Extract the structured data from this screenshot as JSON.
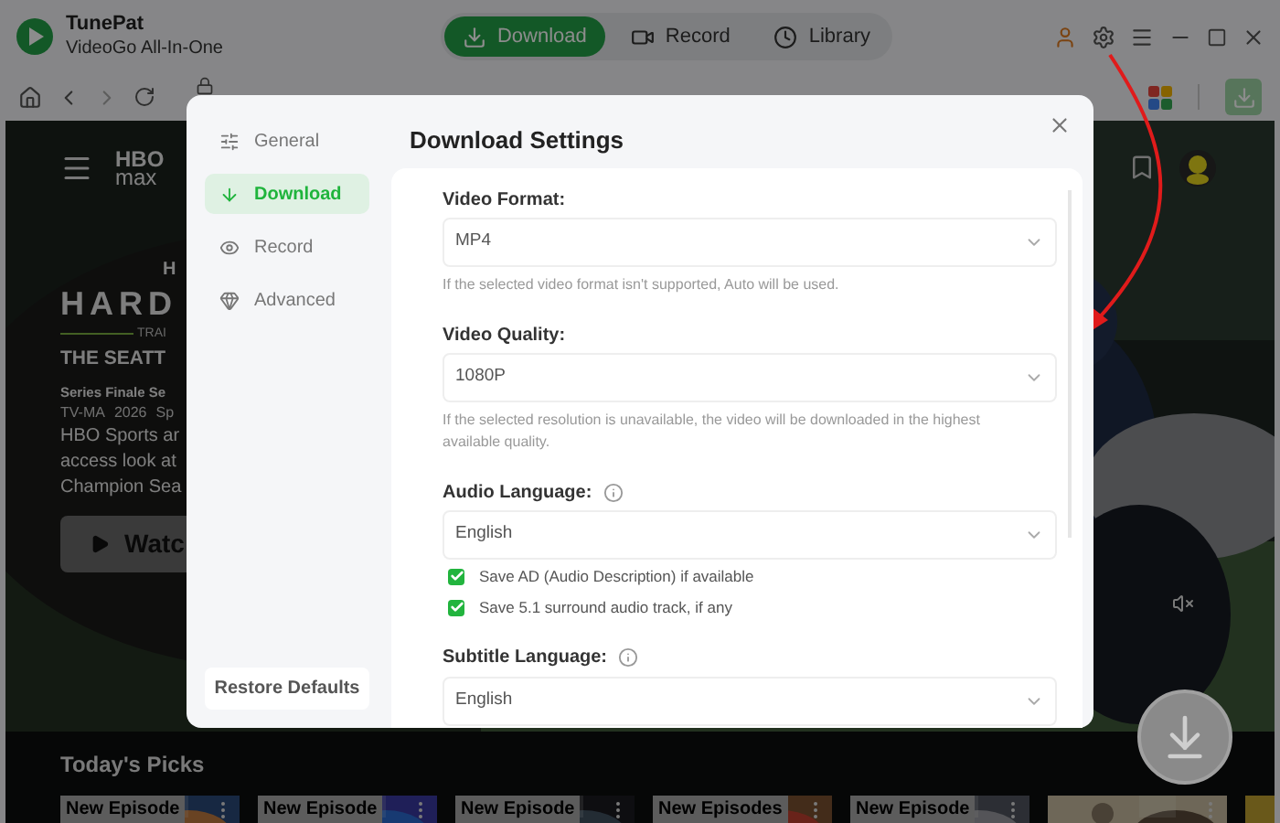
{
  "app": {
    "name": "TunePat",
    "subtitle": "VideoGo All-In-One"
  },
  "tabs": [
    {
      "label": "Download",
      "selected": true
    },
    {
      "label": "Record",
      "selected": false
    },
    {
      "label": "Library",
      "selected": false
    }
  ],
  "browser": {
    "logo": [
      "HBO",
      "max"
    ],
    "hero": {
      "kicker": "H",
      "title": "HARD",
      "tag": "TRAI",
      "subtitle": "THE SEATT",
      "series": "Series Finale Se",
      "meta": [
        "TV-MA",
        "2026",
        "Sp"
      ],
      "description_lines": [
        "HBO Sports ar",
        "access look at",
        "Champion Sea"
      ],
      "play_button": "Watc"
    },
    "section_title": "Today's Picks",
    "cards": [
      {
        "kind": "badged",
        "badge": "New Episode"
      },
      {
        "kind": "badged",
        "badge": "New Episode"
      },
      {
        "kind": "badged",
        "badge": "New Episode"
      },
      {
        "kind": "badged",
        "badge": "New Episodes"
      },
      {
        "kind": "badged",
        "badge": "New Episode"
      },
      {
        "kind": "plain"
      },
      {
        "kind": "plain"
      }
    ]
  },
  "dialog": {
    "nav": [
      {
        "label": "General",
        "selected": false
      },
      {
        "label": "Download",
        "selected": true
      },
      {
        "label": "Record",
        "selected": false
      },
      {
        "label": "Advanced",
        "selected": false
      }
    ],
    "restore_button": "Restore Defaults",
    "title": "Download Settings",
    "fields": [
      {
        "label": "Video Format:",
        "value": "MP4",
        "hint": "If the selected video format isn't supported, Auto will be used."
      },
      {
        "label": "Video Quality:",
        "value": "1080P",
        "hint": "If the selected resolution is unavailable, the video will be downloaded in the highest available quality."
      },
      {
        "label": "Audio Language:",
        "info": true,
        "value": "English",
        "options": [
          {
            "label": "Save AD (Audio Description) if available",
            "checked": true
          },
          {
            "label": "Save 5.1 surround audio track, if any",
            "checked": true
          }
        ]
      },
      {
        "label": "Subtitle Language:",
        "info": true,
        "value": "English"
      }
    ]
  }
}
